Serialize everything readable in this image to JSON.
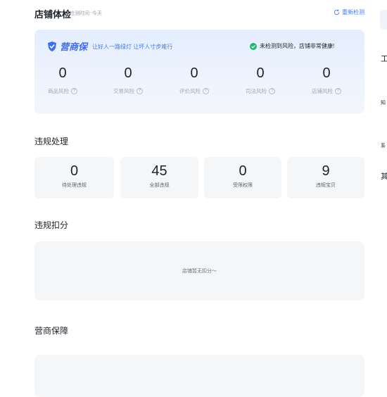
{
  "header": {
    "title": "店铺体检",
    "time_label": "检测时间: 今天",
    "recheck_label": "重新检测"
  },
  "guard": {
    "logo_text": "营商保",
    "slogan": "让好人一路绿灯 让坏人寸步难行",
    "status_text": "未检测到风险，店铺非常健康!",
    "risks": [
      {
        "value": "0",
        "label": "商品风险"
      },
      {
        "value": "0",
        "label": "交易风险"
      },
      {
        "value": "0",
        "label": "评价风险"
      },
      {
        "value": "0",
        "label": "司法风险"
      },
      {
        "value": "0",
        "label": "店铺风险"
      }
    ]
  },
  "violation": {
    "title": "违规处理",
    "items": [
      {
        "value": "0",
        "label": "待处理违规"
      },
      {
        "value": "45",
        "label": "全部违规"
      },
      {
        "value": "0",
        "label": "受限权限"
      },
      {
        "value": "9",
        "label": "违规宝贝"
      }
    ]
  },
  "deduction": {
    "title": "违规扣分",
    "empty_text": "店铺暂无扣分～"
  },
  "business": {
    "title": "营商保障"
  },
  "right_panel": {
    "char1": "工",
    "char2": "知",
    "char3": "系",
    "char4": "其"
  },
  "colors": {
    "accent": "#3e7bfa",
    "success": "#1fba6c",
    "card_bg": "#f5f6f8"
  }
}
